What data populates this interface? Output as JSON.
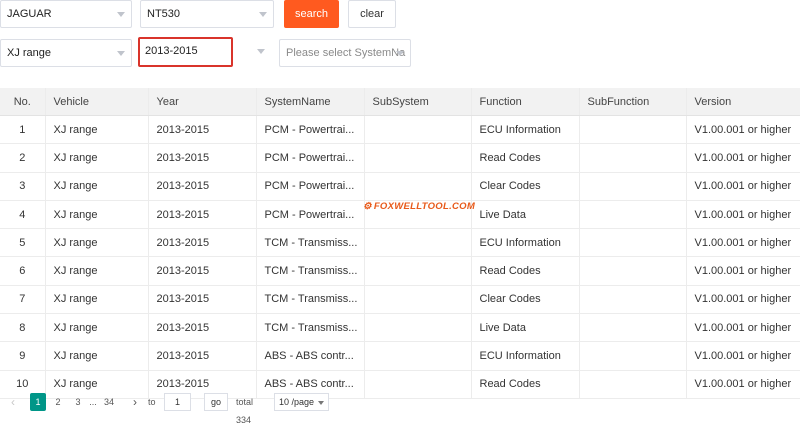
{
  "filters": {
    "make": "JAGUAR",
    "tool": "NT530",
    "model": "XJ range",
    "year": "2013-2015",
    "system_placeholder": "Please select SystemNa"
  },
  "buttons": {
    "search": "search",
    "clear": "clear"
  },
  "table": {
    "headers": [
      "No.",
      "Vehicle",
      "Year",
      "SystemName",
      "SubSystem",
      "Function",
      "SubFunction",
      "Version"
    ],
    "rows": [
      [
        "1",
        "XJ range",
        "2013-2015",
        "PCM - Powertrai...",
        "",
        "ECU Information",
        "",
        "V1.00.001 or higher"
      ],
      [
        "2",
        "XJ range",
        "2013-2015",
        "PCM - Powertrai...",
        "",
        "Read Codes",
        "",
        "V1.00.001 or higher"
      ],
      [
        "3",
        "XJ range",
        "2013-2015",
        "PCM - Powertrai...",
        "",
        "Clear Codes",
        "",
        "V1.00.001 or higher"
      ],
      [
        "4",
        "XJ range",
        "2013-2015",
        "PCM - Powertrai...",
        "",
        "Live Data",
        "",
        "V1.00.001 or higher"
      ],
      [
        "5",
        "XJ range",
        "2013-2015",
        "TCM - Transmiss...",
        "",
        "ECU Information",
        "",
        "V1.00.001 or higher"
      ],
      [
        "6",
        "XJ range",
        "2013-2015",
        "TCM - Transmiss...",
        "",
        "Read Codes",
        "",
        "V1.00.001 or higher"
      ],
      [
        "7",
        "XJ range",
        "2013-2015",
        "TCM - Transmiss...",
        "",
        "Clear Codes",
        "",
        "V1.00.001 or higher"
      ],
      [
        "8",
        "XJ range",
        "2013-2015",
        "TCM - Transmiss...",
        "",
        "Live Data",
        "",
        "V1.00.001 or higher"
      ],
      [
        "9",
        "XJ range",
        "2013-2015",
        "ABS - ABS contr...",
        "",
        "ECU Information",
        "",
        "V1.00.001 or higher"
      ],
      [
        "10",
        "XJ range",
        "2013-2015",
        "ABS - ABS contr...",
        "",
        "Read Codes",
        "",
        "V1.00.001 or higher"
      ]
    ]
  },
  "watermark": "FOXWELLTOOL.COM",
  "pagination": {
    "pages": [
      "1",
      "2",
      "3"
    ],
    "ellipsis": "...",
    "last_page": "34",
    "to_label": "to",
    "jump_value": "1",
    "go_label": "go",
    "total_label": "total 334",
    "page_size": "10 /page"
  },
  "colors": {
    "accent": "#ff5a1f",
    "active_page": "#009688",
    "highlight_border": "#d9342b"
  }
}
